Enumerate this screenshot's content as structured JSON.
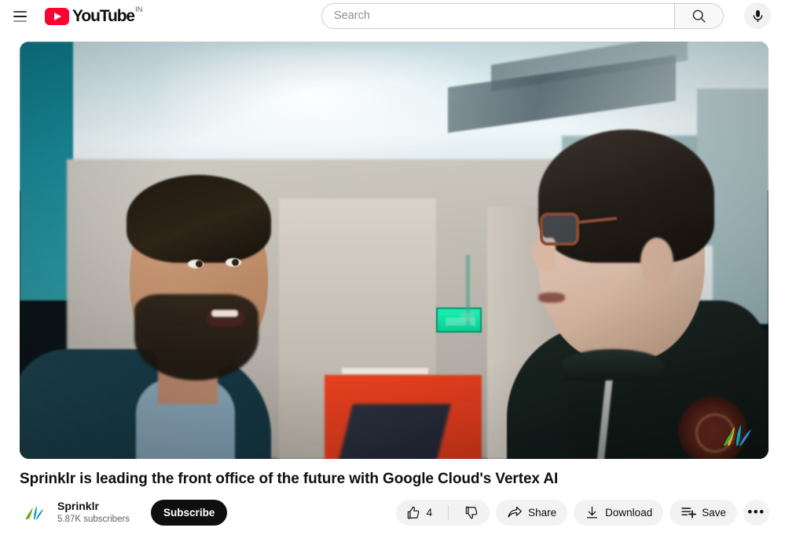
{
  "header": {
    "menu_icon": "hamburger-menu-icon",
    "logo_text": "YouTube",
    "logo_country": "IN",
    "search": {
      "placeholder": "Search",
      "value": "",
      "search_icon": "search-icon",
      "mic_icon": "microphone-icon"
    }
  },
  "video": {
    "title": "Sprinklr is leading the front office of the future with Google Cloud's Vertex AI",
    "watermark": "sprinklr-logo-watermark",
    "scene_description": "Two men talking in an office corridor"
  },
  "channel": {
    "name": "Sprinklr",
    "subscribers": "5.87K subscribers",
    "avatar": "sprinklr-avatar",
    "subscribe_label": "Subscribe"
  },
  "actions": {
    "like_count": "4",
    "like_icon": "thumbs-up-icon",
    "dislike_icon": "thumbs-down-icon",
    "share_label": "Share",
    "share_icon": "share-arrow-icon",
    "download_label": "Download",
    "download_icon": "download-icon",
    "save_label": "Save",
    "save_icon": "save-to-playlist-icon",
    "more_label": "•••",
    "more_icon": "more-horizontal-icon"
  },
  "colors": {
    "youtube_red": "#ff0033",
    "text_primary": "#0f0f0f",
    "text_secondary": "#606060",
    "chip_bg": "#f2f2f2",
    "subscribe_bg": "#0f0f0f"
  }
}
